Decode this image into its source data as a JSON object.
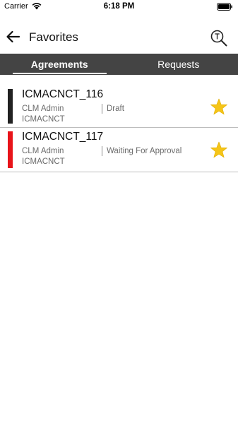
{
  "status_bar": {
    "carrier": "Carrier",
    "time": "6:18 PM"
  },
  "nav": {
    "title": "Favorites",
    "back_icon": "arrow-left-icon",
    "search_icon": "search-icon"
  },
  "tabs": [
    {
      "label": "Agreements",
      "active": true
    },
    {
      "label": "Requests",
      "active": false
    }
  ],
  "agreements": [
    {
      "title": "ICMACNCT_116",
      "owner": "CLM Admin",
      "status": "Draft",
      "org": "ICMACNCT",
      "bar_color": "#222222",
      "favorite": true
    },
    {
      "title": "ICMACNCT_117",
      "owner": "CLM Admin",
      "status": "Waiting For Approval",
      "org": "ICMACNCT",
      "bar_color": "#e8141a",
      "favorite": true
    }
  ],
  "colors": {
    "tab_bar": "#444444",
    "star": "#f5c518",
    "text_secondary": "#6b6b6b"
  }
}
